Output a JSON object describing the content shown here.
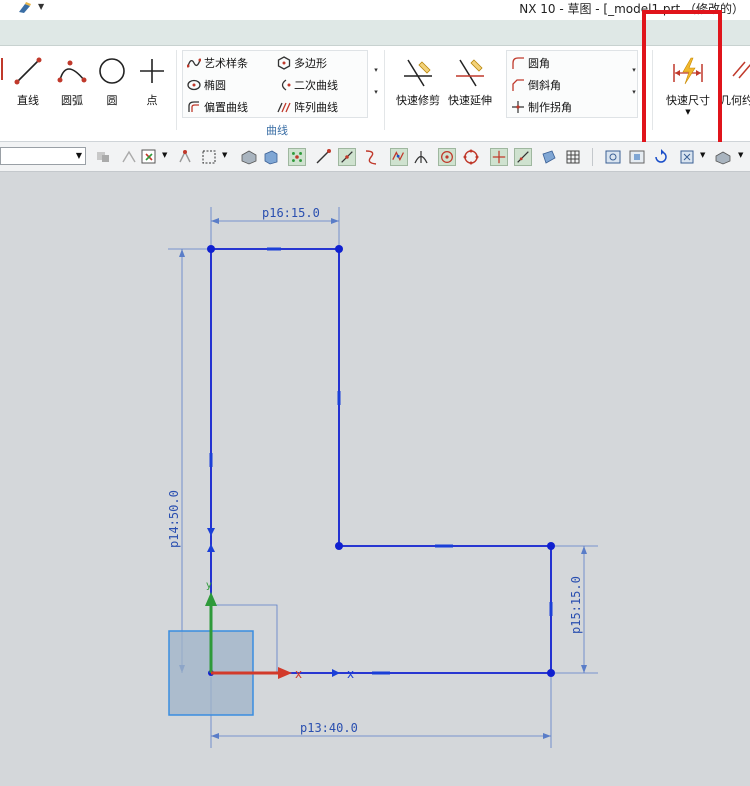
{
  "app": {
    "title": "NX 10 - 草图 - [_model1.prt （修改的）"
  },
  "ribbon": {
    "big_buttons": [
      {
        "label": "直线",
        "icon": "line-icon"
      },
      {
        "label": "圆弧",
        "icon": "arc-icon"
      },
      {
        "label": "圆",
        "icon": "circle-icon"
      },
      {
        "label": "点",
        "icon": "point-icon"
      }
    ],
    "curve_group": {
      "left_column": [
        "艺术样条",
        "椭圆",
        "偏置曲线"
      ],
      "right_column": [
        "多边形",
        "二次曲线",
        "阵列曲线"
      ],
      "label": "曲线"
    },
    "trim_buttons": [
      {
        "label": "快速修剪",
        "icon": "quick-trim-icon"
      },
      {
        "label": "快速延伸",
        "icon": "quick-extend-icon"
      }
    ],
    "corner_group": [
      "圆角",
      "倒斜角",
      "制作拐角"
    ],
    "dimension_button": {
      "label": "快速尺寸",
      "icon": "rapid-dimension-icon"
    },
    "partial_button": {
      "label": "几何约"
    }
  },
  "colors": {
    "sketch_line": "#1020d0",
    "dimension": "#2a4fb0",
    "highlight": "#e0141b",
    "axis_x": "#d23a2a",
    "axis_y": "#2e9a3a",
    "canvas_bg": "#d4d7da"
  },
  "sketch": {
    "dimensions": {
      "top": "p16:15.0",
      "left": "p14:50.0",
      "right": "p15:15.0",
      "bottom": "p13:40.0"
    }
  }
}
